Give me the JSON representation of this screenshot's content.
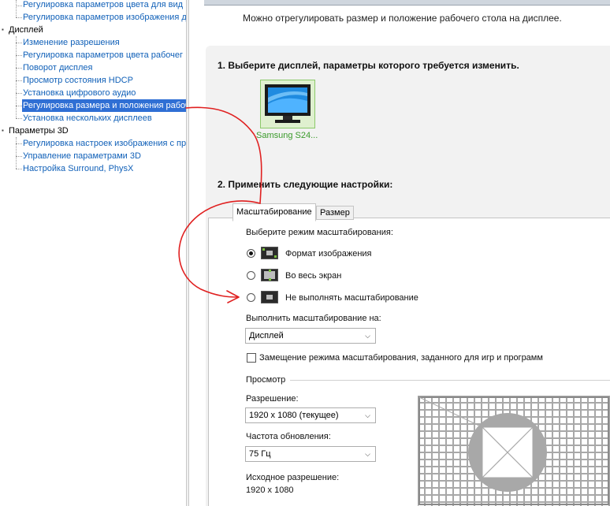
{
  "sidebar": {
    "items": [
      {
        "label": "Регулировка параметров цвета для вид",
        "type": "link"
      },
      {
        "label": "Регулировка параметров изображения д",
        "type": "link"
      },
      {
        "label": "Дисплей",
        "type": "category"
      },
      {
        "label": "Изменение разрешения",
        "type": "link"
      },
      {
        "label": "Регулировка параметров цвета рабочег",
        "type": "link"
      },
      {
        "label": "Поворот дисплея",
        "type": "link"
      },
      {
        "label": "Просмотр состояния HDCP",
        "type": "link"
      },
      {
        "label": "Установка цифрового аудио",
        "type": "link"
      },
      {
        "label": "Регулировка размера и положения рабоч",
        "type": "link",
        "selected": true
      },
      {
        "label": "Установка нескольких дисплеев",
        "type": "link"
      },
      {
        "label": "Параметры 3D",
        "type": "category"
      },
      {
        "label": "Регулировка настроек изображения с пр",
        "type": "link"
      },
      {
        "label": "Управление параметрами 3D",
        "type": "link"
      },
      {
        "label": "Настройка Surround, PhysX",
        "type": "link"
      }
    ]
  },
  "main": {
    "description": "Можно отрегулировать размер и положение рабочего стола на дисплее.",
    "step1_title": "1. Выберите дисплей, параметры которого требуется изменить.",
    "display_name": "Samsung S24...",
    "step2_title": "2. Применить следующие настройки:",
    "tabs": [
      {
        "label": "Масштабирование",
        "active": true
      },
      {
        "label": "Размер",
        "active": false
      }
    ],
    "scaling_mode_label": "Выберите режим масштабирования:",
    "modes": [
      {
        "label": "Формат изображения",
        "selected": true,
        "icon": "aspect-ratio-icon"
      },
      {
        "label": "Во весь экран",
        "selected": false,
        "icon": "full-screen-icon"
      },
      {
        "label": "Не выполнять масштабирование",
        "selected": false,
        "icon": "no-scaling-icon"
      }
    ],
    "perform_on_label": "Выполнить масштабирование на:",
    "perform_on_value": "Дисплей",
    "override_label": "Замещение режима масштабирования, заданного для игр и программ",
    "override_checked": false,
    "preview_label": "Просмотр",
    "resolution_label": "Разрешение:",
    "resolution_value": "1920 x 1080 (текущее)",
    "refresh_label": "Частота обновления:",
    "refresh_value": "75 Гц",
    "native_label": "Исходное разрешение:",
    "native_value": "1920 x 1080"
  },
  "colors": {
    "link": "#1060b8",
    "selected_bg": "#2f6fd4",
    "annotation_arrow": "#e02020",
    "display_label": "#3a9a2a"
  }
}
